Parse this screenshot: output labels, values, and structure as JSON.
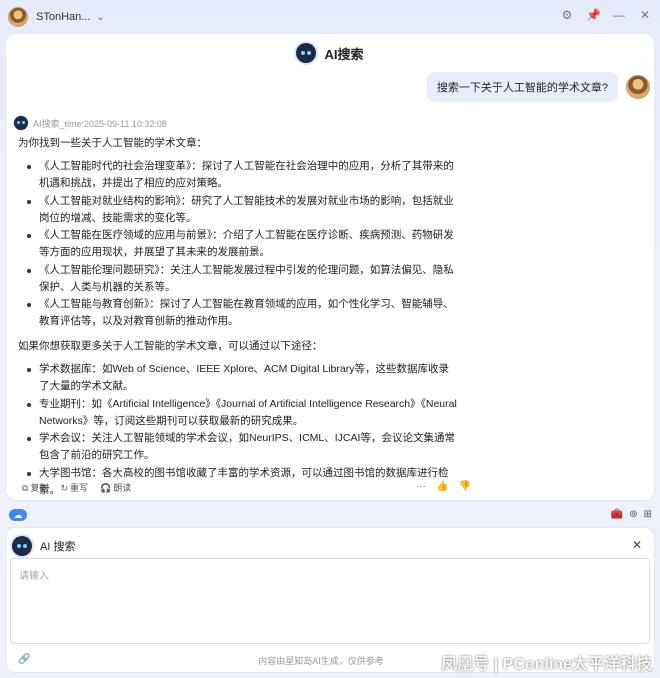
{
  "titlebar": {
    "username": "STonHan...",
    "chevron": "chevron-down-icon",
    "controls": [
      "gear-icon",
      "pin-icon",
      "minimize-icon",
      "close-icon"
    ]
  },
  "header": {
    "title": "AI搜索"
  },
  "user_message": {
    "text": "搜索一下关于人工智能的学术文章?"
  },
  "bot_meta": {
    "label": "AI搜索_time:2025-09-11 10:32:08"
  },
  "answer": {
    "intro": "为你找到一些关于人工智能的学术文章：",
    "articles": [
      "《人工智能时代的社会治理变革》：探讨了人工智能在社会治理中的应用，分析了其带来的机遇和挑战，并提出了相应的应对策略。",
      "《人工智能对就业结构的影响》：研究了人工智能技术的发展对就业市场的影响，包括就业岗位的增减、技能需求的变化等。",
      "《人工智能在医疗领域的应用与前景》：介绍了人工智能在医疗诊断、疾病预测、药物研发等方面的应用现状，并展望了其未来的发展前景。",
      "《人工智能伦理问题研究》：关注人工智能发展过程中引发的伦理问题，如算法偏见、隐私保护、人类与机器的关系等。",
      "《人工智能与教育创新》：探讨了人工智能在教育领域的应用，如个性化学习、智能辅导、教育评估等，以及对教育创新的推动作用。"
    ],
    "more_intro": "如果你想获取更多关于人工智能的学术文章，可以通过以下途径：",
    "ways": [
      "学术数据库：如Web of Science、IEEE Xplore、ACM Digital Library等，这些数据库收录了大量的学术文献。",
      "专业期刊：如《Artificial Intelligence》《Journal of Artificial Intelligence Research》《Neural Networks》等，订阅这些期刊可以获取最新的研究成果。",
      "学术会议：关注人工智能领域的学术会议，如NeurIPS、ICML、IJCAI等，会议论文集通常包含了前沿的研究工作。",
      "大学图书馆：各大高校的图书馆收藏了丰富的学术资源，可以通过图书馆的数据库进行检索。"
    ]
  },
  "actions": {
    "copy": "复制",
    "rewrite": "重写",
    "read": "朗读",
    "more": "···"
  },
  "input": {
    "title": "AI 搜索",
    "placeholder": "请输入",
    "footer_note": "内容由星知岛AI生成，仅供参考"
  },
  "watermark": "凤凰号 | PConline太平洋科技"
}
